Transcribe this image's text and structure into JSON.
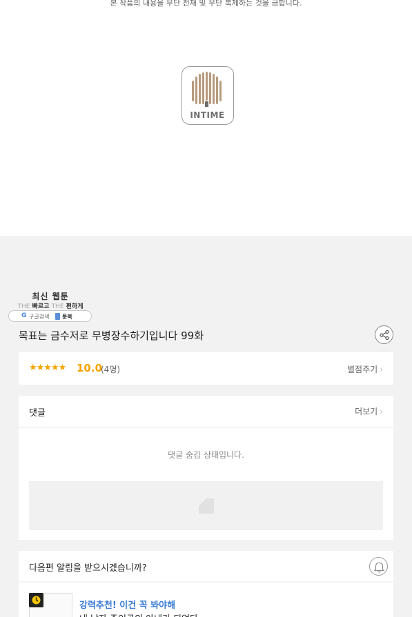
{
  "header": {
    "copyright_notice": "본 작품의 내용을 무단 전재 및 무단 복제하는 것을 금합니다.",
    "publisher_logo_text": "INTIME"
  },
  "promo_badge": {
    "line1": "최신 웹툰",
    "line2_prefix": "THE",
    "line2_word1": "빠르고",
    "line2_mid": "THE",
    "line2_word2": "편하게",
    "google_label": "구글검색",
    "site_label": "툰북"
  },
  "episode": {
    "title": "목표는 금수저로 무병장수하기입니다 99화"
  },
  "rating": {
    "stars": "★★★★★",
    "score": "10.0",
    "count": "(4명)",
    "rate_label": "별점주기"
  },
  "comments": {
    "title": "댓글",
    "more_label": "더보기",
    "hidden_message": "댓글 숨김 상태입니다."
  },
  "notify": {
    "question": "다음편 알림을 받으시겠습니까?"
  },
  "recommendation": {
    "label": "강력추천! 이건 꼭 봐야해",
    "title": "내 남자 주인공의 아내가 되었다"
  },
  "colors": {
    "accent_orange": "#f5a300",
    "link_blue": "#3a7bd5",
    "page_bg": "#f2f2f2"
  },
  "icons": {
    "share": "share-icon",
    "bell": "bell-icon",
    "clock": "clock-icon",
    "chevron": "chevron-right-icon"
  }
}
